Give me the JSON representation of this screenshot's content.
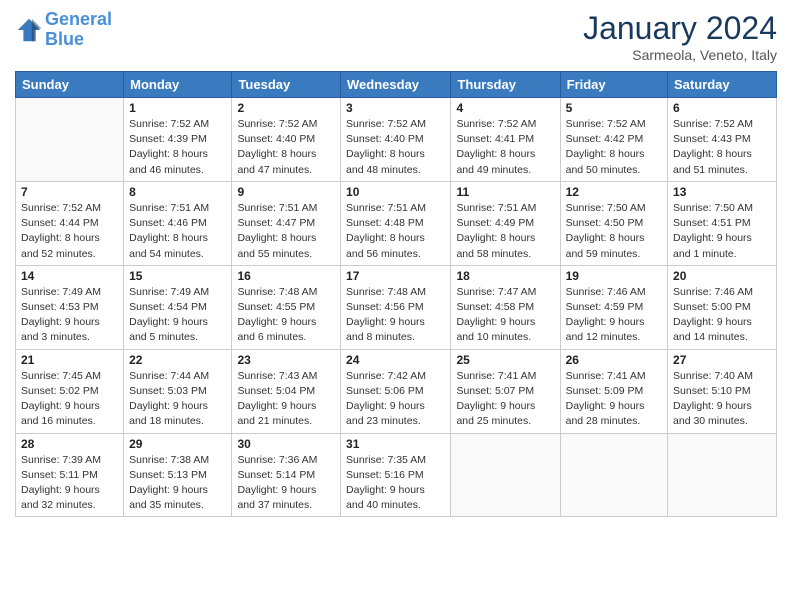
{
  "header": {
    "logo_line1": "General",
    "logo_line2": "Blue",
    "month": "January 2024",
    "location": "Sarmeola, Veneto, Italy"
  },
  "weekdays": [
    "Sunday",
    "Monday",
    "Tuesday",
    "Wednesday",
    "Thursday",
    "Friday",
    "Saturday"
  ],
  "weeks": [
    [
      {
        "day": "",
        "content": ""
      },
      {
        "day": "1",
        "content": "Sunrise: 7:52 AM\nSunset: 4:39 PM\nDaylight: 8 hours\nand 46 minutes."
      },
      {
        "day": "2",
        "content": "Sunrise: 7:52 AM\nSunset: 4:40 PM\nDaylight: 8 hours\nand 47 minutes."
      },
      {
        "day": "3",
        "content": "Sunrise: 7:52 AM\nSunset: 4:40 PM\nDaylight: 8 hours\nand 48 minutes."
      },
      {
        "day": "4",
        "content": "Sunrise: 7:52 AM\nSunset: 4:41 PM\nDaylight: 8 hours\nand 49 minutes."
      },
      {
        "day": "5",
        "content": "Sunrise: 7:52 AM\nSunset: 4:42 PM\nDaylight: 8 hours\nand 50 minutes."
      },
      {
        "day": "6",
        "content": "Sunrise: 7:52 AM\nSunset: 4:43 PM\nDaylight: 8 hours\nand 51 minutes."
      }
    ],
    [
      {
        "day": "7",
        "content": "Sunrise: 7:52 AM\nSunset: 4:44 PM\nDaylight: 8 hours\nand 52 minutes."
      },
      {
        "day": "8",
        "content": "Sunrise: 7:51 AM\nSunset: 4:46 PM\nDaylight: 8 hours\nand 54 minutes."
      },
      {
        "day": "9",
        "content": "Sunrise: 7:51 AM\nSunset: 4:47 PM\nDaylight: 8 hours\nand 55 minutes."
      },
      {
        "day": "10",
        "content": "Sunrise: 7:51 AM\nSunset: 4:48 PM\nDaylight: 8 hours\nand 56 minutes."
      },
      {
        "day": "11",
        "content": "Sunrise: 7:51 AM\nSunset: 4:49 PM\nDaylight: 8 hours\nand 58 minutes."
      },
      {
        "day": "12",
        "content": "Sunrise: 7:50 AM\nSunset: 4:50 PM\nDaylight: 8 hours\nand 59 minutes."
      },
      {
        "day": "13",
        "content": "Sunrise: 7:50 AM\nSunset: 4:51 PM\nDaylight: 9 hours\nand 1 minute."
      }
    ],
    [
      {
        "day": "14",
        "content": "Sunrise: 7:49 AM\nSunset: 4:53 PM\nDaylight: 9 hours\nand 3 minutes."
      },
      {
        "day": "15",
        "content": "Sunrise: 7:49 AM\nSunset: 4:54 PM\nDaylight: 9 hours\nand 5 minutes."
      },
      {
        "day": "16",
        "content": "Sunrise: 7:48 AM\nSunset: 4:55 PM\nDaylight: 9 hours\nand 6 minutes."
      },
      {
        "day": "17",
        "content": "Sunrise: 7:48 AM\nSunset: 4:56 PM\nDaylight: 9 hours\nand 8 minutes."
      },
      {
        "day": "18",
        "content": "Sunrise: 7:47 AM\nSunset: 4:58 PM\nDaylight: 9 hours\nand 10 minutes."
      },
      {
        "day": "19",
        "content": "Sunrise: 7:46 AM\nSunset: 4:59 PM\nDaylight: 9 hours\nand 12 minutes."
      },
      {
        "day": "20",
        "content": "Sunrise: 7:46 AM\nSunset: 5:00 PM\nDaylight: 9 hours\nand 14 minutes."
      }
    ],
    [
      {
        "day": "21",
        "content": "Sunrise: 7:45 AM\nSunset: 5:02 PM\nDaylight: 9 hours\nand 16 minutes."
      },
      {
        "day": "22",
        "content": "Sunrise: 7:44 AM\nSunset: 5:03 PM\nDaylight: 9 hours\nand 18 minutes."
      },
      {
        "day": "23",
        "content": "Sunrise: 7:43 AM\nSunset: 5:04 PM\nDaylight: 9 hours\nand 21 minutes."
      },
      {
        "day": "24",
        "content": "Sunrise: 7:42 AM\nSunset: 5:06 PM\nDaylight: 9 hours\nand 23 minutes."
      },
      {
        "day": "25",
        "content": "Sunrise: 7:41 AM\nSunset: 5:07 PM\nDaylight: 9 hours\nand 25 minutes."
      },
      {
        "day": "26",
        "content": "Sunrise: 7:41 AM\nSunset: 5:09 PM\nDaylight: 9 hours\nand 28 minutes."
      },
      {
        "day": "27",
        "content": "Sunrise: 7:40 AM\nSunset: 5:10 PM\nDaylight: 9 hours\nand 30 minutes."
      }
    ],
    [
      {
        "day": "28",
        "content": "Sunrise: 7:39 AM\nSunset: 5:11 PM\nDaylight: 9 hours\nand 32 minutes."
      },
      {
        "day": "29",
        "content": "Sunrise: 7:38 AM\nSunset: 5:13 PM\nDaylight: 9 hours\nand 35 minutes."
      },
      {
        "day": "30",
        "content": "Sunrise: 7:36 AM\nSunset: 5:14 PM\nDaylight: 9 hours\nand 37 minutes."
      },
      {
        "day": "31",
        "content": "Sunrise: 7:35 AM\nSunset: 5:16 PM\nDaylight: 9 hours\nand 40 minutes."
      },
      {
        "day": "",
        "content": ""
      },
      {
        "day": "",
        "content": ""
      },
      {
        "day": "",
        "content": ""
      }
    ]
  ]
}
